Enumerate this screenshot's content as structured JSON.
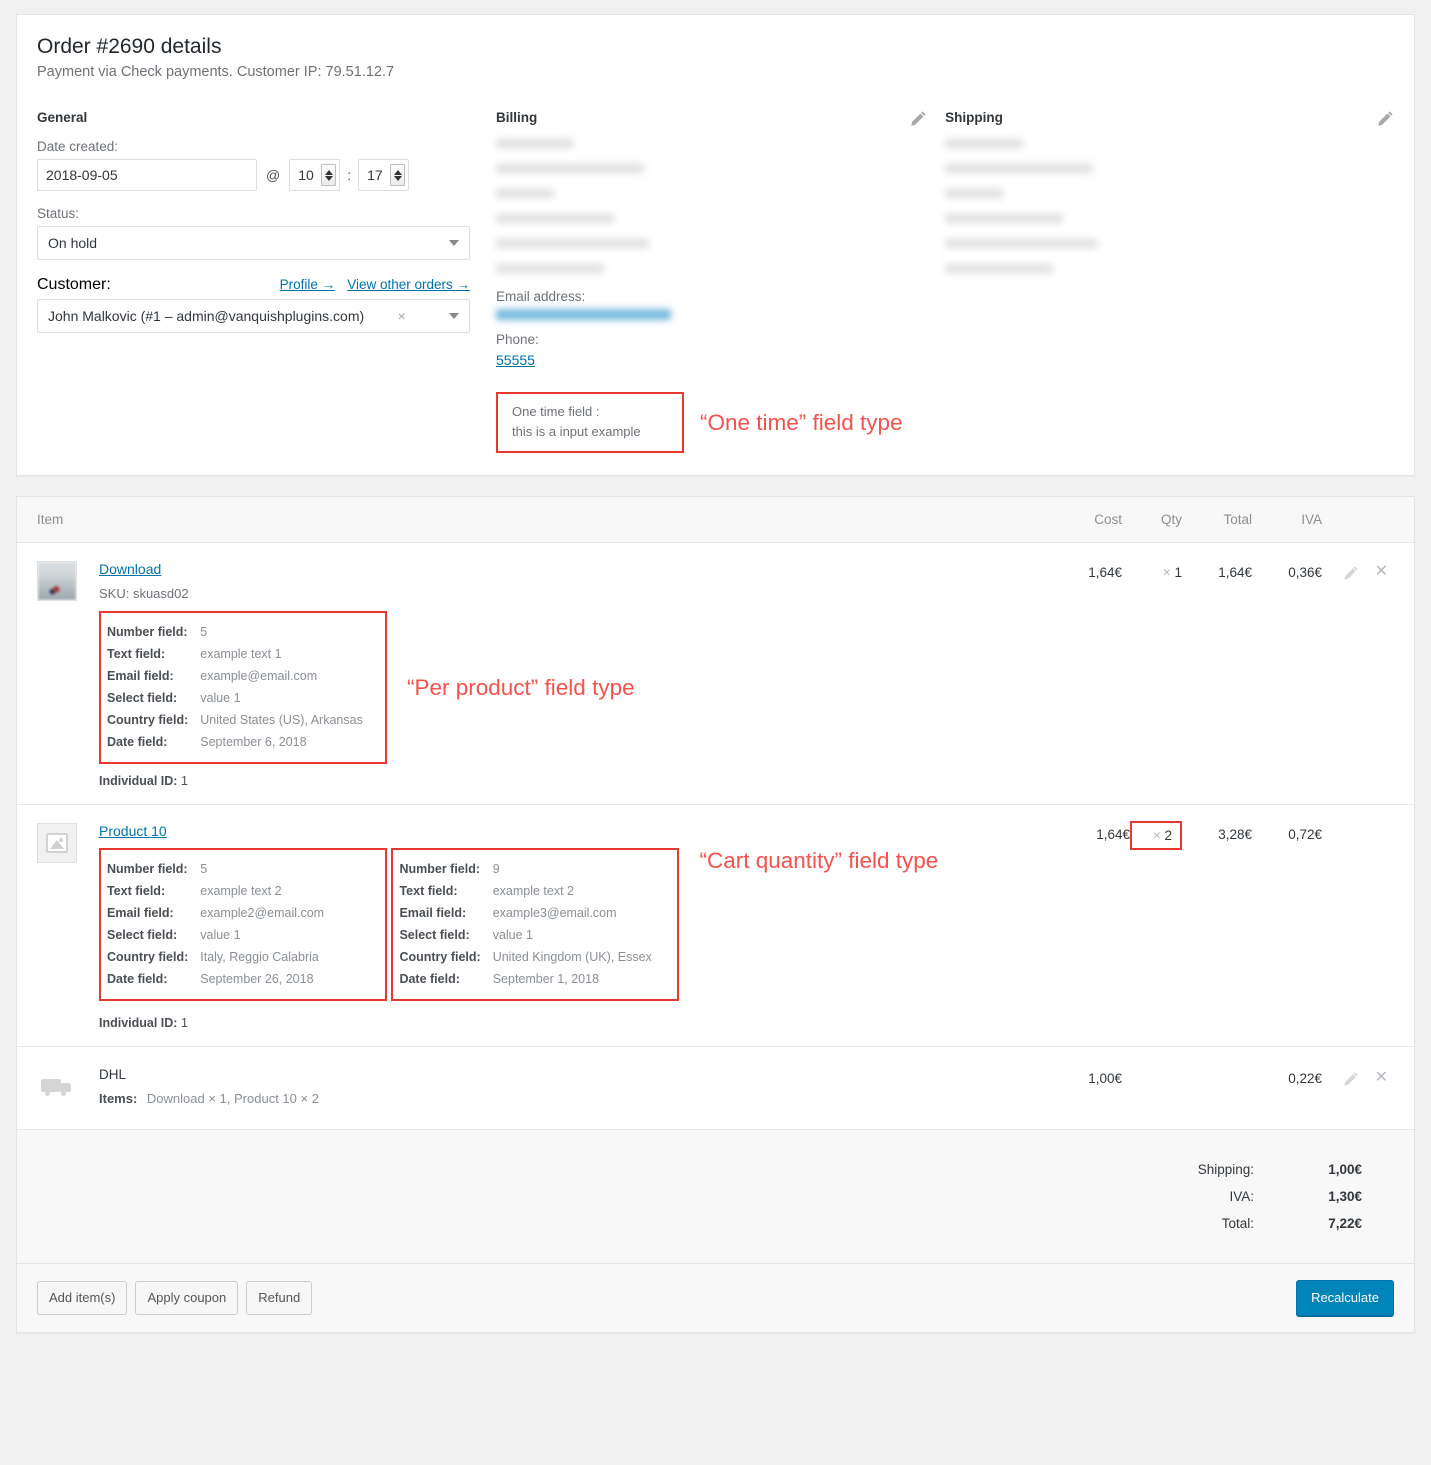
{
  "order": {
    "title": "Order #2690 details",
    "subtitle": "Payment via Check payments. Customer IP: 79.51.12.7"
  },
  "general": {
    "heading": "General",
    "date_label": "Date created:",
    "date_value": "2018-09-05",
    "at": "@",
    "hour": "10",
    "colon": ":",
    "minute": "17",
    "status_label": "Status:",
    "status_value": "On hold",
    "customer_label": "Customer:",
    "profile_link": "Profile →",
    "other_orders_link": "View other orders →",
    "customer_value": "John Malkovic (#1 – admin@vanquishplugins.com)",
    "clear_symbol": "×"
  },
  "billing": {
    "heading": "Billing",
    "email_label": "Email address:",
    "phone_label": "Phone:",
    "phone_value": "55555"
  },
  "shipping_col": {
    "heading": "Shipping"
  },
  "one_time": {
    "label": "One time field :",
    "value": "this is a input example",
    "callout": "“One time” field type"
  },
  "callouts": {
    "per_product": "“Per product” field type",
    "cart_quantity": "“Cart quantity” field type"
  },
  "items_table": {
    "headers": {
      "item": "Item",
      "cost": "Cost",
      "qty": "Qty",
      "total": "Total",
      "iva": "IVA"
    },
    "rows": [
      {
        "name": "Download",
        "sku": "SKU: skuasd02",
        "thumb": "photo-thumbnail",
        "cost": "1,64€",
        "qty_mult": "×",
        "qty": "1",
        "total": "1,64€",
        "iva": "0,36€",
        "has_actions": true,
        "qty_boxed": false,
        "individual_id_label": "Individual ID:",
        "individual_id": "1",
        "meta_groups": [
          {
            "fields": [
              {
                "key": "Number field:",
                "value": "5"
              },
              {
                "key": "Text field:",
                "value": "example text 1"
              },
              {
                "key": "Email field:",
                "value": "example@email.com"
              },
              {
                "key": "Select field:",
                "value": "value 1"
              },
              {
                "key": "Country field:",
                "value": "United States (US), Arkansas"
              },
              {
                "key": "Date field:",
                "value": "September 6, 2018"
              }
            ]
          }
        ]
      },
      {
        "name": "Product 10",
        "sku": "",
        "thumb": "placeholder-thumbnail",
        "cost": "1,64€",
        "qty_mult": "×",
        "qty": "2",
        "total": "3,28€",
        "iva": "0,72€",
        "has_actions": false,
        "qty_boxed": true,
        "individual_id_label": "Individual ID:",
        "individual_id": "1",
        "meta_groups": [
          {
            "fields": [
              {
                "key": "Number field:",
                "value": "5"
              },
              {
                "key": "Text field:",
                "value": "example text 2"
              },
              {
                "key": "Email field:",
                "value": "example2@email.com"
              },
              {
                "key": "Select field:",
                "value": "value 1"
              },
              {
                "key": "Country field:",
                "value": "Italy, Reggio Calabria"
              },
              {
                "key": "Date field:",
                "value": "September 26, 2018"
              }
            ]
          },
          {
            "fields": [
              {
                "key": "Number field:",
                "value": "9"
              },
              {
                "key": "Text field:",
                "value": "example text 2"
              },
              {
                "key": "Email field:",
                "value": "example3@email.com"
              },
              {
                "key": "Select field:",
                "value": "value 1"
              },
              {
                "key": "Country field:",
                "value": "United Kingdom (UK), Essex"
              },
              {
                "key": "Date field:",
                "value": "September 1, 2018"
              }
            ]
          }
        ]
      }
    ],
    "shipping_line": {
      "name": "DHL",
      "items_label": "Items:",
      "items_value": "Download × 1, Product 10 × 2",
      "cost": "1,00€",
      "iva": "0,22€"
    }
  },
  "totals": [
    {
      "label": "Shipping:",
      "amount": "1,00€"
    },
    {
      "label": "IVA:",
      "amount": "1,30€"
    },
    {
      "label": "Total:",
      "amount": "7,22€"
    }
  ],
  "footer": {
    "add_items": "Add item(s)",
    "apply_coupon": "Apply coupon",
    "refund": "Refund",
    "recalculate": "Recalculate"
  },
  "colors": {
    "accent_red": "#e8392f",
    "callout_red": "#f4524a",
    "link_blue": "#0073aa",
    "primary_blue": "#0085ba"
  }
}
